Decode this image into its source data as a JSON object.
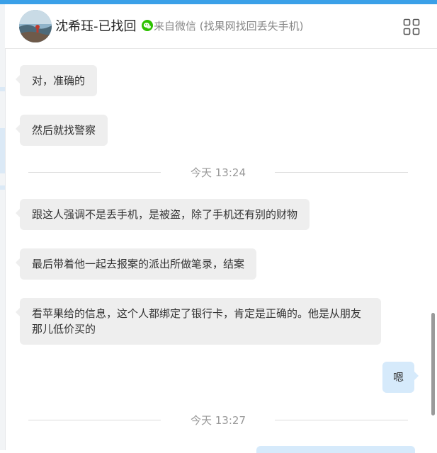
{
  "header": {
    "contact_name": "沈希珏-已找回",
    "source_text": "来自微信 (找果网找回丢失手机)"
  },
  "icons": {
    "source": "wechat-icon",
    "menu": "grid-menu-icon"
  },
  "colors": {
    "accent": "#3aa0e8",
    "incoming_bubble": "#eeeeee",
    "outgoing_bubble": "#d6eafb",
    "wechat_green": "#2dc100"
  },
  "messages": [
    {
      "side": "left",
      "text": "对，准确的"
    },
    {
      "side": "left",
      "text": "然后就找警察"
    },
    {
      "type": "time",
      "text": "今天 13:24"
    },
    {
      "side": "left",
      "text": "跟这人强调不是丢手机，是被盗，除了手机还有别的财物"
    },
    {
      "side": "left",
      "text": "最后带着他一起去报案的派出所做笔录，结案"
    },
    {
      "side": "left",
      "text": "看苹果给的信息，这个人都绑定了银行卡，肯定是正确的。他是从朋友那儿低价买的"
    },
    {
      "side": "right",
      "text": "嗯"
    },
    {
      "type": "time",
      "text": "今天 13:27"
    }
  ]
}
